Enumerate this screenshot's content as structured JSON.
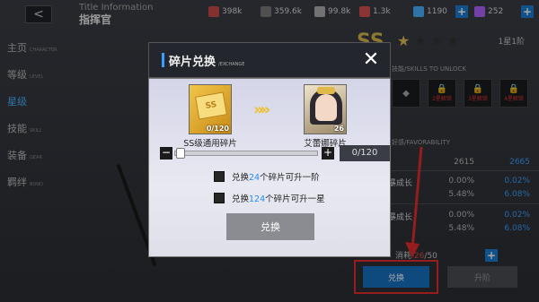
{
  "header": {
    "back_label": "<",
    "title_en": "Title Information",
    "title_cn": "指挥官",
    "resources": [
      {
        "icon": "fuel-icon",
        "value": "398k",
        "color": "#c94a4a"
      },
      {
        "icon": "ammo-icon",
        "value": "359.6k",
        "color": "#7a7a7a"
      },
      {
        "icon": "parts-icon",
        "value": "99.8k",
        "color": "#b0b0b0"
      },
      {
        "icon": "ticket-icon",
        "value": "1.3k",
        "color": "#d65050"
      },
      {
        "icon": "coin-icon",
        "value": "1190",
        "color": "#4ab2ff"
      },
      {
        "icon": "gem-icon",
        "value": "252",
        "color": "#b164ff"
      }
    ],
    "plus": "+"
  },
  "sidemenu": [
    {
      "label": "主页",
      "sub": "CHARACTER"
    },
    {
      "label": "等级",
      "sub": "LEVEL"
    },
    {
      "label": "星级",
      "sub": ""
    },
    {
      "label": "技能",
      "sub": "SKILL"
    },
    {
      "label": "装备",
      "sub": "GEAR"
    },
    {
      "label": "羁绊",
      "sub": "BOND"
    }
  ],
  "right": {
    "rarity": "SS",
    "stars": "★★★★",
    "rank": "1星1阶",
    "skill_title": "技能/SKILLS TO UNLOCK",
    "skill_slots": [
      {
        "text": ""
      },
      {
        "text": "2星解锁"
      },
      {
        "text": "3星解锁"
      },
      {
        "text": "4星解锁"
      }
    ],
    "fav_title": "好感/FAVORABILITY",
    "stats": [
      {
        "label": "",
        "v1": "2615",
        "v2": "2665"
      },
      {
        "label": "暴成长",
        "v1": "0.00%",
        "v2": "0.02%"
      },
      {
        "label": "",
        "v1": "5.48%",
        "v2": "6.08%"
      },
      {
        "label": "暴成长",
        "v1": "0.00%",
        "v2": "0.02%"
      },
      {
        "label": "",
        "v1": "5.48%",
        "v2": "6.08%"
      }
    ],
    "favor_label": "消耗",
    "favor_value": "26",
    "favor_max": "/50",
    "exchange_btn": "兑换",
    "awaken_btn": "升阶"
  },
  "modal": {
    "title": "碎片兑换",
    "title_sub": "/EXCHANGE",
    "close": "✕",
    "left_card": {
      "count": "0/120",
      "label": "SS级通用碎片",
      "glyph": "SS"
    },
    "right_card": {
      "count": "26",
      "label": "艾蕾娜碎片"
    },
    "arrows": "»»",
    "slider": {
      "minus": "−",
      "plus": "+",
      "value": "0/120",
      "progress": 0.0
    },
    "option1": {
      "prefix": "兑换",
      "num": "24",
      "suffix": "个碎片可升一阶"
    },
    "option2": {
      "prefix": "兑换",
      "num": "124",
      "suffix": "个碎片可升一星"
    },
    "confirm": "兑换"
  }
}
